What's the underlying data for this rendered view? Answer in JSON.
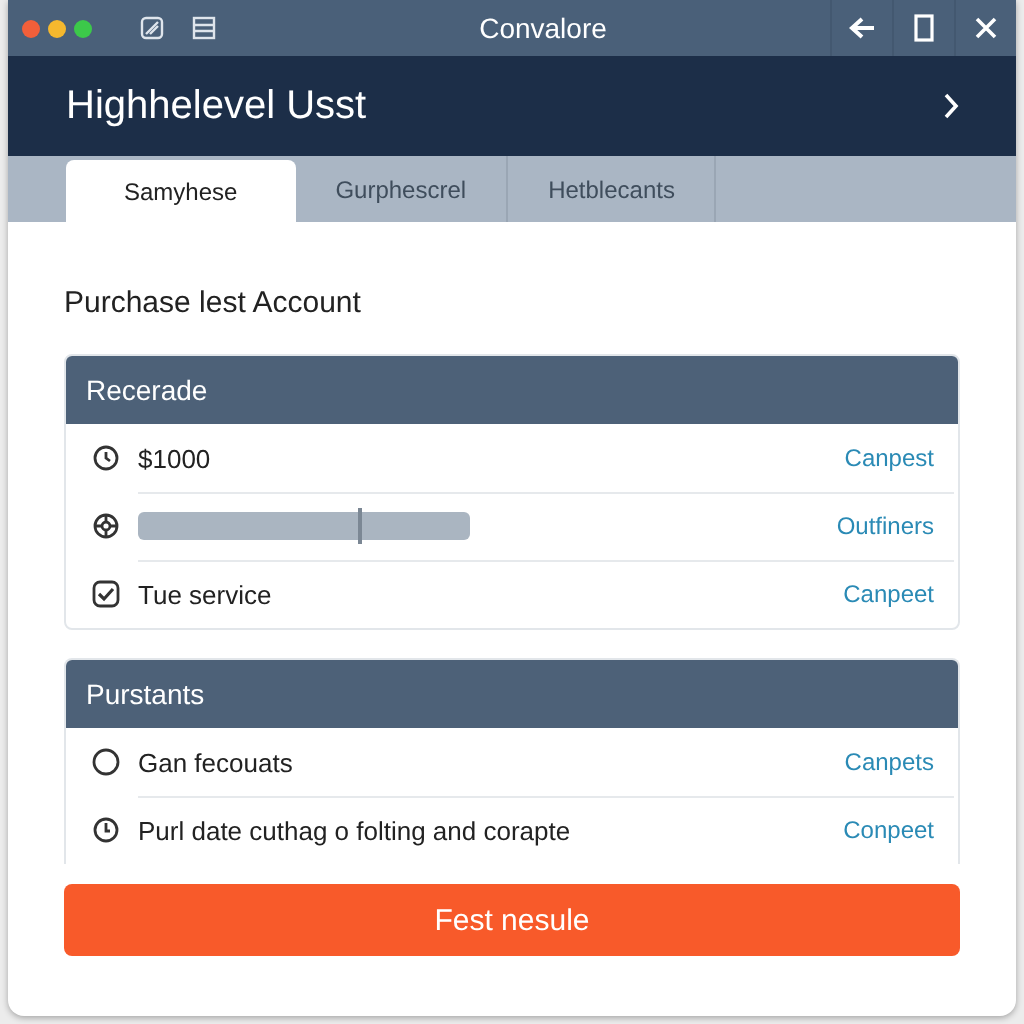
{
  "window": {
    "title": "Convalore"
  },
  "header": {
    "title": "Highhelevel Usst"
  },
  "tabs": [
    {
      "label": "Samyhese",
      "selected": true
    },
    {
      "label": "Gurphescrel",
      "selected": false
    },
    {
      "label": "Hetblecants",
      "selected": false
    }
  ],
  "page_title": "Purchase lest Account",
  "sections": [
    {
      "title": "Recerade",
      "rows": [
        {
          "kind": "clock",
          "label": "$1000",
          "action": "Canpest"
        },
        {
          "kind": "slider",
          "level": 0.66,
          "action": "Outfiners"
        },
        {
          "kind": "checkbox",
          "checked": true,
          "label": "Tue service",
          "action": "Canpeet"
        }
      ]
    },
    {
      "title": "Purstants",
      "rows": [
        {
          "kind": "radio",
          "selected": false,
          "label": "Gan fecouats",
          "action": "Canpets"
        },
        {
          "kind": "timer",
          "label": "Purl date cuthag o folting and corapte",
          "action": "Conpeet"
        }
      ]
    }
  ],
  "primary_button": "Fest nesule"
}
